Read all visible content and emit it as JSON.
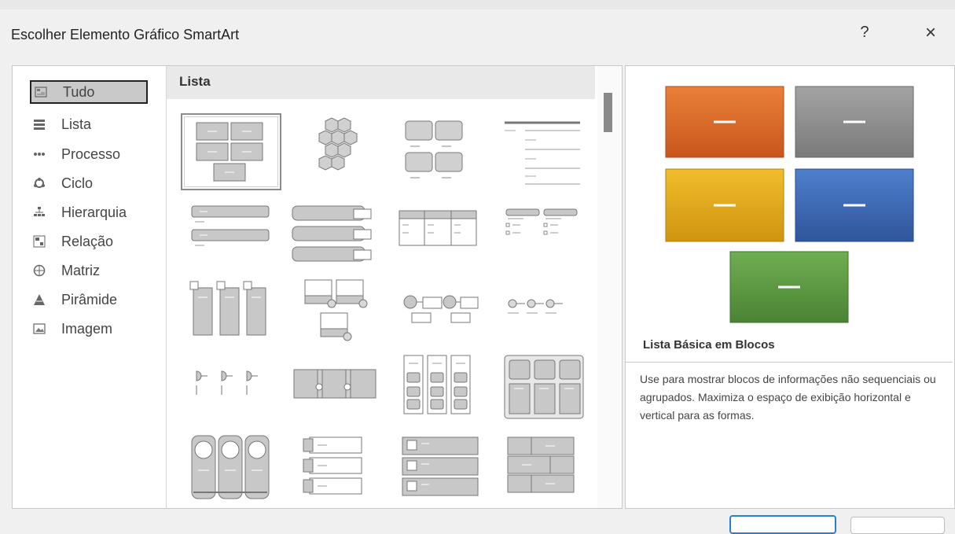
{
  "dialog": {
    "title": "Escolher Elemento Gráfico SmartArt",
    "help_label": "?",
    "close_label": "×"
  },
  "sidebar": {
    "items": [
      {
        "label": "Tudo",
        "icon": "all-icon",
        "selected": true
      },
      {
        "label": "Lista",
        "icon": "list-icon"
      },
      {
        "label": "Processo",
        "icon": "process-icon"
      },
      {
        "label": "Ciclo",
        "icon": "cycle-icon"
      },
      {
        "label": "Hierarquia",
        "icon": "hierarchy-icon"
      },
      {
        "label": "Relação",
        "icon": "relationship-icon"
      },
      {
        "label": "Matriz",
        "icon": "matrix-icon"
      },
      {
        "label": "Pirâmide",
        "icon": "pyramid-icon"
      },
      {
        "label": "Imagem",
        "icon": "picture-icon"
      }
    ]
  },
  "gallery": {
    "header": "Lista",
    "layouts": [
      {
        "name": "basic-block-list",
        "selected": true
      },
      {
        "name": "hexagon-cluster"
      },
      {
        "name": "grouped-blocks"
      },
      {
        "name": "lined-list"
      },
      {
        "name": "vertical-bullet-list"
      },
      {
        "name": "stacked-list"
      },
      {
        "name": "table-list"
      },
      {
        "name": "horizontal-bullet-list"
      },
      {
        "name": "picture-caption-list"
      },
      {
        "name": "picture-accent-blocks"
      },
      {
        "name": "circle-accent-timeline"
      },
      {
        "name": "circle-process"
      },
      {
        "name": "pin-list"
      },
      {
        "name": "accent-process"
      },
      {
        "name": "tab-list"
      },
      {
        "name": "picture-strips"
      },
      {
        "name": "circular-picture-list"
      },
      {
        "name": "vertical-tab-list"
      },
      {
        "name": "vertical-box-list"
      },
      {
        "name": "brick-list"
      }
    ]
  },
  "preview": {
    "name": "Lista Básica em Blocos",
    "description": "Use para mostrar blocos de informações não sequenciais ou agrupados. Maximiza o espaço de exibição horizontal e vertical para as formas.",
    "colors": {
      "orange": "#dc6a2a",
      "gray": "#8e8e8e",
      "gold": "#e0a81a",
      "blue": "#3a67b3",
      "green": "#5b9741"
    }
  }
}
